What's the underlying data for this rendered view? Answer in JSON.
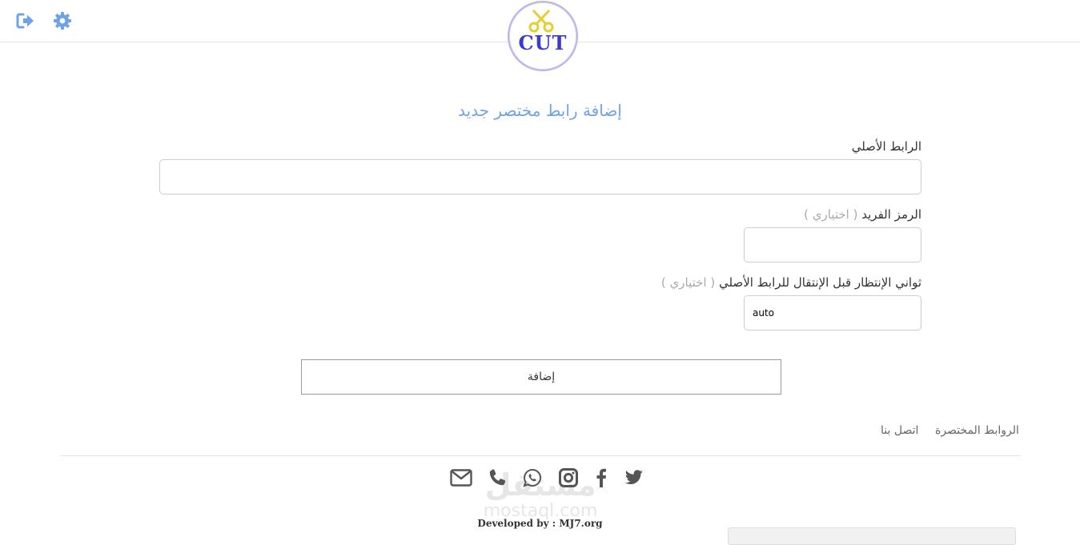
{
  "header": {
    "logo_text": "CUT",
    "icons": {
      "logout": "sign-out-icon",
      "settings": "gear-icon"
    },
    "accent": "#6fa3e8"
  },
  "form": {
    "title": "إضافة رابط مختصر جديد",
    "url_label": "الرابط الأصلي",
    "url_value": "",
    "code_label": "الرمز الفريد",
    "code_optional": "( اختياري )",
    "code_value": "",
    "delay_label": "ثواني الإنتظار قبل الإنتقال للرابط الأصلي",
    "delay_optional": "( اختياري )",
    "delay_value": "auto",
    "submit_label": "إضافة"
  },
  "footer": {
    "links": [
      "الروابط المختصرة",
      "اتصل بنا"
    ],
    "social": [
      "twitter-icon",
      "facebook-icon",
      "instagram-icon",
      "whatsapp-icon",
      "phone-icon",
      "email-icon"
    ],
    "watermark_ar": "مستقل",
    "watermark_en": "mostaql.com",
    "credit": "Developed by : MJ7.org"
  }
}
